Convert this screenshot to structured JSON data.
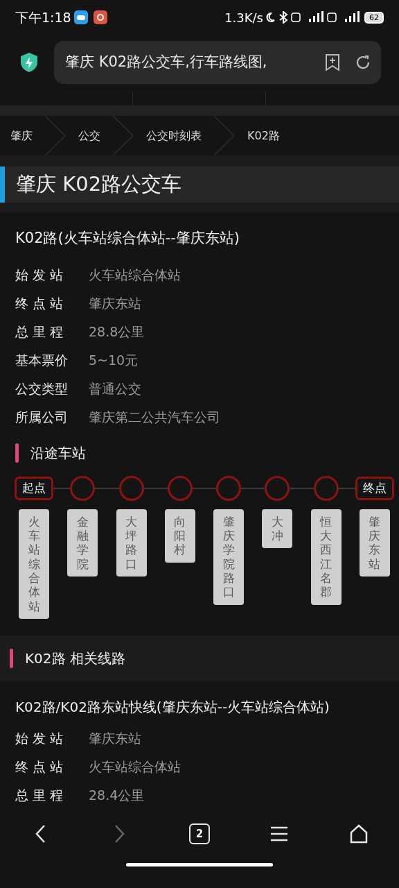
{
  "status_bar": {
    "time": "下午1:18",
    "speed": "1.3K/s",
    "battery": "62"
  },
  "url_bar": {
    "value": "肇庆 K02路公交车,行车路线图,"
  },
  "breadcrumb": [
    "肇庆",
    "公交",
    "公交时刻表",
    "K02路"
  ],
  "page_title": "肇庆 K02路公交车",
  "route": {
    "name": "K02路(火车站综合体站--肇庆东站)",
    "info": [
      {
        "label": "始 发 站",
        "value": "火车站综合体站"
      },
      {
        "label": "终 点 站",
        "value": "肇庆东站"
      },
      {
        "label": "总 里 程",
        "value": "28.8公里"
      },
      {
        "label": "基本票价",
        "value": "5~10元"
      },
      {
        "label": "公交类型",
        "value": "普通公交"
      },
      {
        "label": "所属公司",
        "value": "肇庆第二公共汽车公司"
      }
    ]
  },
  "stations_heading": "沿途车站",
  "stations": [
    {
      "kind": "start",
      "marker": "起点",
      "name": "火车站综合体站"
    },
    {
      "kind": "stop",
      "name": "金融学院"
    },
    {
      "kind": "stop",
      "name": "大坪路口"
    },
    {
      "kind": "stop",
      "name": "向阳村"
    },
    {
      "kind": "stop",
      "name": "肇庆学院路口"
    },
    {
      "kind": "stop",
      "name": "大冲"
    },
    {
      "kind": "stop",
      "name": "恒大西江名郡"
    },
    {
      "kind": "end",
      "marker": "终点",
      "name": "肇庆东站"
    }
  ],
  "related_heading": "K02路 相关线路",
  "related": [
    {
      "name": "K02路/K02路东站快线(肇庆东站--火车站综合体站)",
      "info": [
        {
          "label": "始 发 站",
          "value": "肇庆东站"
        },
        {
          "label": "终 点 站",
          "value": "火车站综合体站"
        },
        {
          "label": "总 里 程",
          "value": "28.4公里"
        }
      ]
    }
  ],
  "nav": {
    "back_disabled": false,
    "forward_disabled": true,
    "tab_count": "2"
  }
}
